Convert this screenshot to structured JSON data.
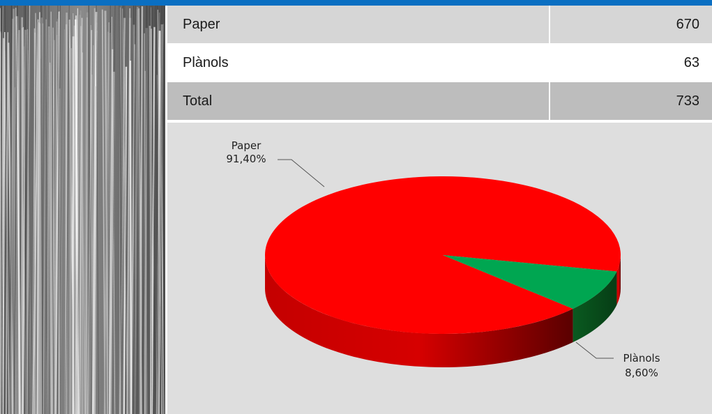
{
  "table": {
    "rows": [
      {
        "label": "Paper",
        "value": "670"
      },
      {
        "label": "Plànols",
        "value": "63"
      },
      {
        "label": "Total",
        "value": "733"
      }
    ]
  },
  "chart_data": {
    "type": "pie",
    "categories": [
      "Paper",
      "Plànols"
    ],
    "values": [
      91.4,
      8.6
    ],
    "labels": [
      {
        "name": "Paper",
        "percent": "91,40%"
      },
      {
        "name": "Plànols",
        "percent": "8,60%"
      }
    ],
    "colors": [
      "#ff0000",
      "#00a651"
    ],
    "three_d": true
  }
}
